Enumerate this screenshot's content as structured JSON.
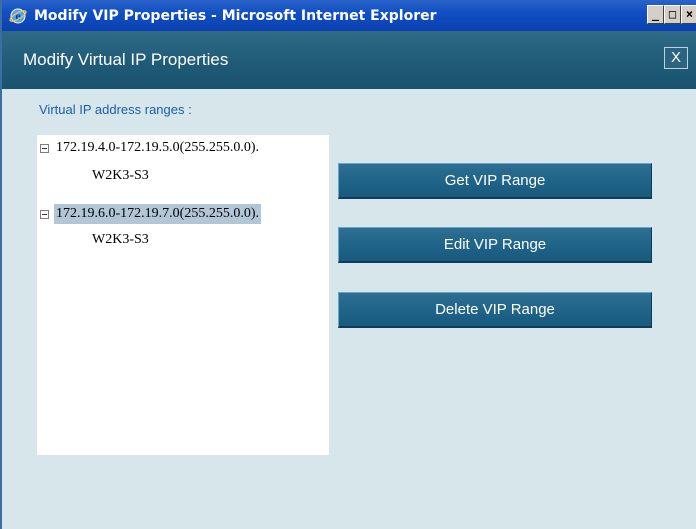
{
  "window": {
    "title": "Modify VIP Properties - Microsoft Internet Explorer",
    "controls": {
      "minimize": "_",
      "maximize": "□",
      "close": "×"
    }
  },
  "dialog": {
    "title": "Modify Virtual IP Properties",
    "close_label": "X",
    "section_label": "Virtual IP address ranges :"
  },
  "tree": [
    {
      "range": "172.19.4.0-172.19.5.0(255.255.0.0).",
      "child": "W2K3-S3",
      "selected": false
    },
    {
      "range": "172.19.6.0-172.19.7.0(255.255.0.0).",
      "child": "W2K3-S3",
      "selected": true
    }
  ],
  "buttons": {
    "get": "Get VIP Range",
    "edit": "Edit VIP Range",
    "delete": "Delete VIP Range"
  },
  "colors": {
    "ie_titlebar": "#0a3fb0",
    "dialog_header": "#1e5a76",
    "dialog_body": "#d6e6ea",
    "button": "#1f6388",
    "section_label": "#1c5ea8",
    "selection": "#b2c6d8"
  }
}
